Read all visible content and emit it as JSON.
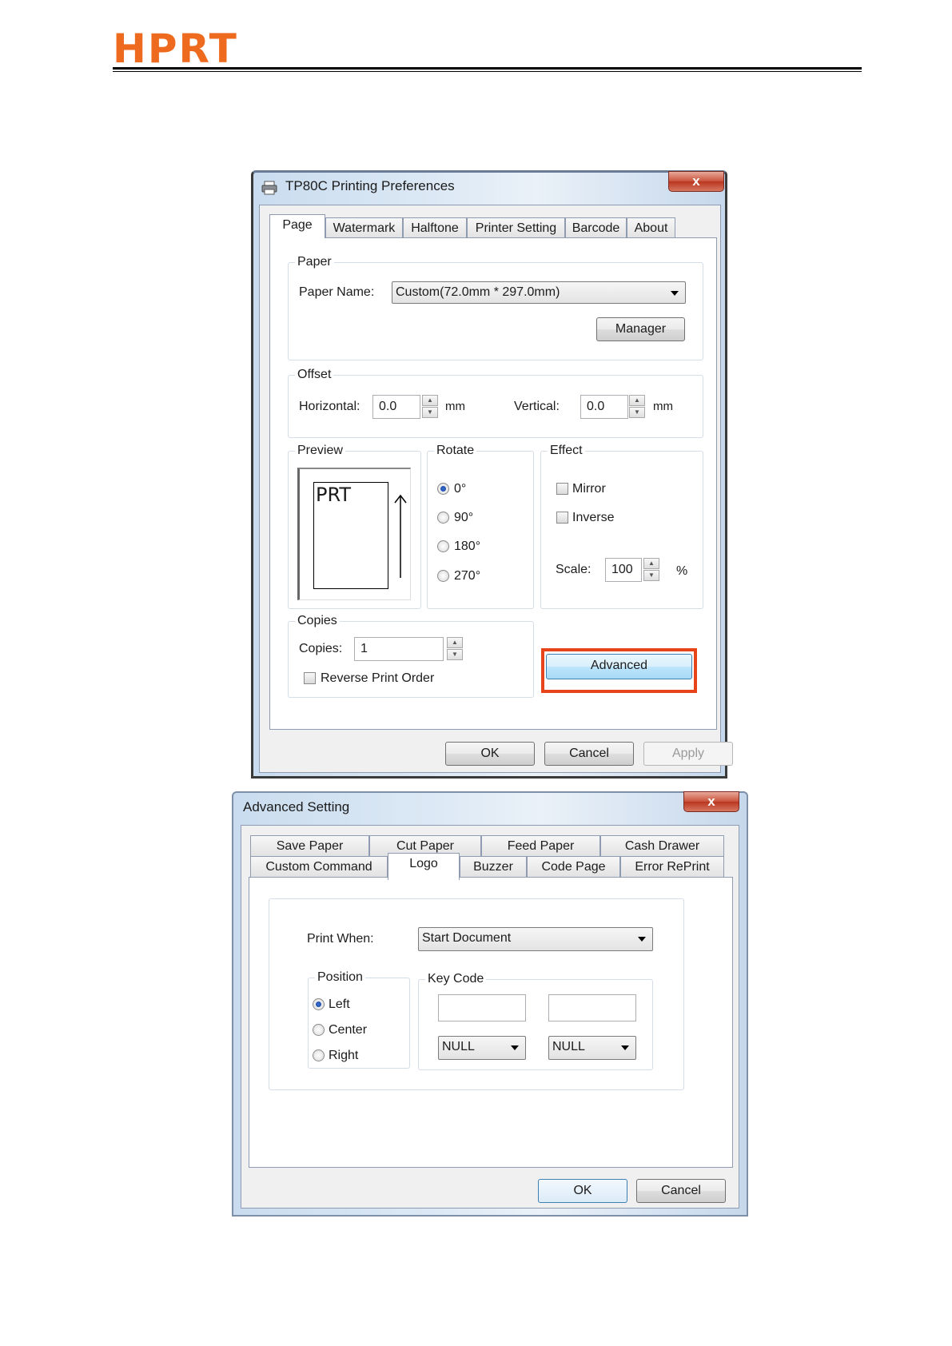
{
  "header": {
    "logo_text": "HPRT"
  },
  "prefs": {
    "title": "TP80C Printing Preferences",
    "close_glyph": "x",
    "tabs": [
      "Page",
      "Watermark",
      "Halftone",
      "Printer Setting",
      "Barcode",
      "About"
    ],
    "paper": {
      "group": "Paper",
      "name_label": "Paper Name:",
      "name_value": "Custom(72.0mm * 297.0mm)",
      "manager": "Manager"
    },
    "offset": {
      "group": "Offset",
      "horizontal_label": "Horizontal:",
      "horizontal_value": "0.0",
      "vertical_label": "Vertical:",
      "vertical_value": "0.0",
      "unit": "mm"
    },
    "preview": {
      "group": "Preview",
      "sample_text": "PRT"
    },
    "rotate": {
      "group": "Rotate",
      "options": [
        "0°",
        "90°",
        "180°",
        "270°"
      ],
      "selected": "0°"
    },
    "effect": {
      "group": "Effect",
      "mirror": "Mirror",
      "inverse": "Inverse",
      "scale_label": "Scale:",
      "scale_value": "100",
      "scale_unit": "%"
    },
    "copies": {
      "group": "Copies",
      "label": "Copies:",
      "value": "1",
      "reverse": "Reverse Print Order"
    },
    "advanced": "Advanced",
    "highlight_color": "#e8441a",
    "buttons": {
      "ok": "OK",
      "cancel": "Cancel",
      "apply": "Apply"
    }
  },
  "advanced": {
    "title": "Advanced Setting",
    "close_glyph": "x",
    "tabs_row1": [
      "Save Paper",
      "Cut Paper",
      "Feed Paper",
      "Cash Drawer"
    ],
    "tabs_row2": [
      "Custom Command",
      "Logo",
      "Buzzer",
      "Code Page",
      "Error RePrint"
    ],
    "print_when_label": "Print When:",
    "print_when_value": "Start Document",
    "position": {
      "group": "Position",
      "options": [
        "Left",
        "Center",
        "Right"
      ],
      "selected": "Left"
    },
    "keycode": {
      "group": "Key Code",
      "field1": "",
      "field2": "",
      "select1": "NULL",
      "select2": "NULL"
    },
    "buttons": {
      "ok": "OK",
      "cancel": "Cancel"
    }
  }
}
